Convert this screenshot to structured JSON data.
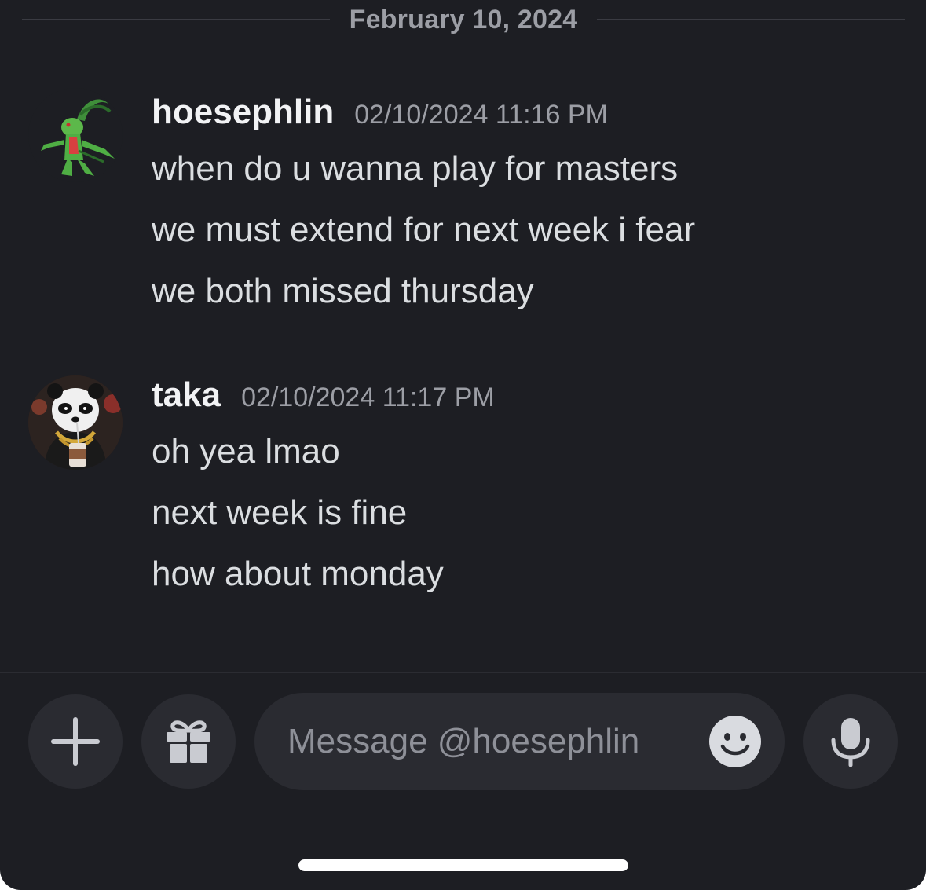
{
  "date_divider": "February 10, 2024",
  "messages": [
    {
      "author": "hoesephlin",
      "timestamp": "02/10/2024 11:16 PM",
      "lines": [
        "when do u wanna play for masters",
        "we must extend for next week i fear",
        "we both missed thursday"
      ]
    },
    {
      "author": "taka",
      "timestamp": "02/10/2024 11:17 PM",
      "lines": [
        "oh yea lmao",
        "next week is fine",
        "how about monday"
      ]
    }
  ],
  "composer": {
    "placeholder": "Message @hoesephlin",
    "add_icon": "plus-icon",
    "gift_icon": "gift-icon",
    "emoji_icon": "smile-icon",
    "mic_icon": "microphone-icon"
  },
  "colors": {
    "background": "#1d1e23",
    "button_bg": "#2a2b31",
    "author": "#f2f3f5",
    "message_text": "#dbdee1",
    "muted": "#9c9ea5"
  }
}
